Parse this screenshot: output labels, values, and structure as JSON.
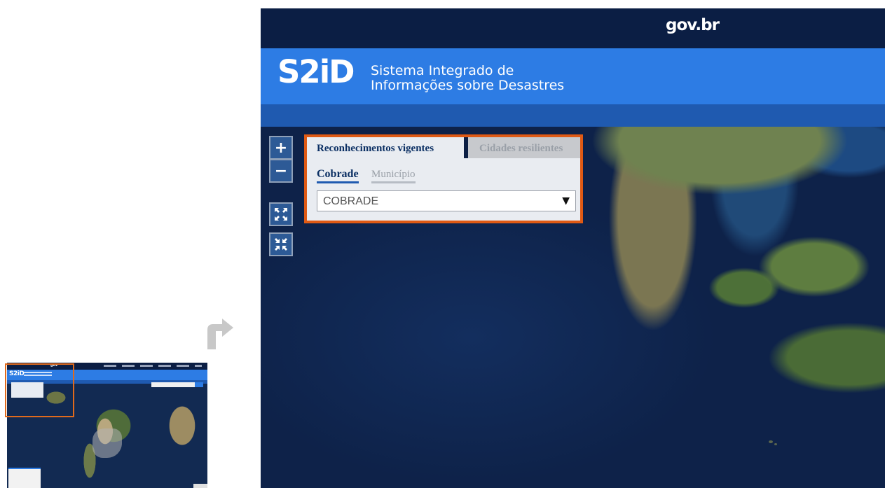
{
  "gov_logo": "gov.br",
  "header": {
    "logo": "S2iD",
    "subtitle_line1": "Sistema Integrado de",
    "subtitle_line2": "Informações sobre Desastres"
  },
  "map_controls": {
    "zoom_in": "+",
    "zoom_out": "−",
    "fullscreen_icon": "expand-icon",
    "exit_fullscreen_icon": "collapse-icon"
  },
  "panel": {
    "tabs": [
      {
        "label": "Reconhecimentos vigentes",
        "active": true
      },
      {
        "label": "Cidades resilientes",
        "active": false
      }
    ],
    "subtabs": [
      {
        "label": "Cobrade",
        "active": true
      },
      {
        "label": "Município",
        "active": false
      }
    ],
    "select": {
      "value": "COBRADE",
      "caret": "▼"
    }
  },
  "colors": {
    "gov_bar": "#0b1e44",
    "header_blue": "#2d7ce4",
    "highlight_border": "#e05a14",
    "arrow": "#c8c8c8"
  }
}
